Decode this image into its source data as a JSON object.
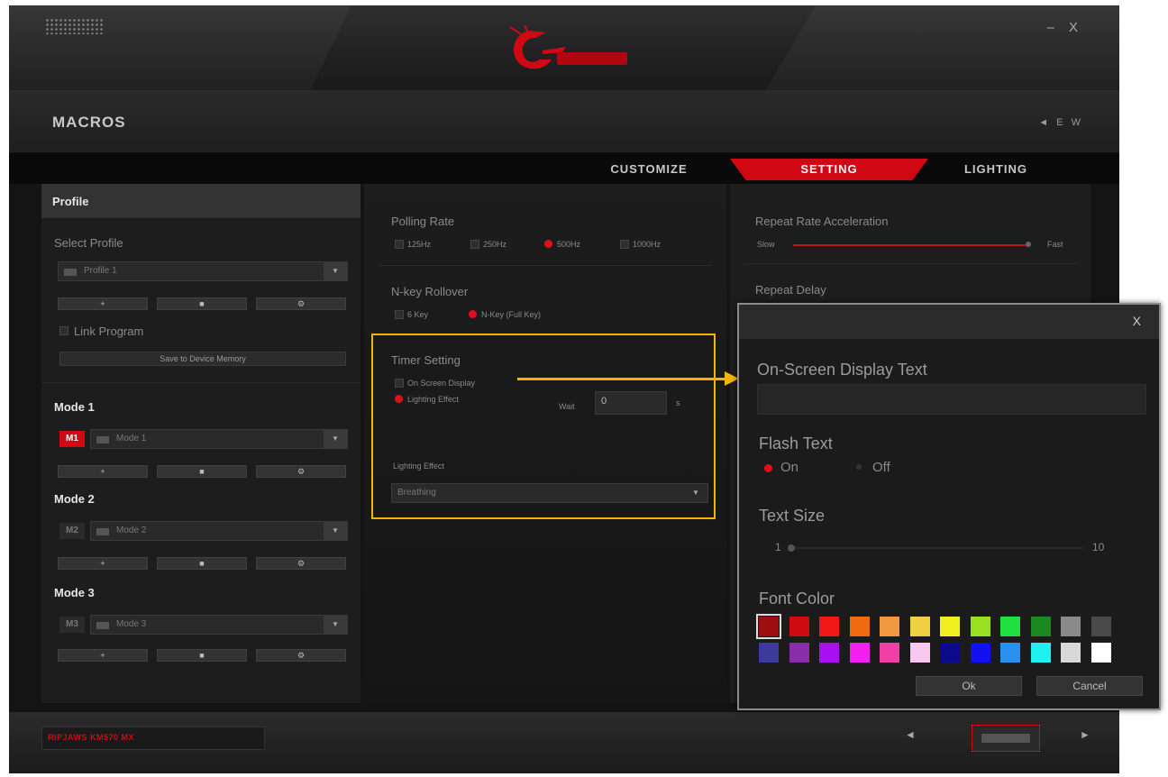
{
  "window": {
    "minimize": "–",
    "close": "X"
  },
  "header": {
    "page_title": "MACROS",
    "language": "◄ E W"
  },
  "tabs": [
    {
      "label": "CUSTOMIZE"
    },
    {
      "label": "SETTING"
    },
    {
      "label": "LIGHTING"
    }
  ],
  "profile": {
    "heading": "Profile",
    "select_label": "Select Profile",
    "selected": "Profile 1",
    "btn_add": "+",
    "btn_delete": "■",
    "btn_settings": "⚙",
    "link_program": "Link Program",
    "save_button": "Save to Device Memory"
  },
  "modes": [
    {
      "heading": "Mode 1",
      "badge": "M1",
      "selected": "Mode 1"
    },
    {
      "heading": "Mode 2",
      "badge": "M2",
      "selected": "Mode 2"
    },
    {
      "heading": "Mode 3",
      "badge": "M3",
      "selected": "Mode 3"
    }
  ],
  "polling": {
    "heading": "Polling Rate",
    "options": [
      "125Hz",
      "250Hz",
      "500Hz",
      "1000Hz"
    ],
    "selected": "500Hz"
  },
  "nkey": {
    "heading": "N-key Rollover",
    "options": [
      "6 Key",
      "N-Key (Full Key)"
    ],
    "selected": "N-Key (Full Key)"
  },
  "timer": {
    "heading": "Timer Setting",
    "opt_osd": "On Screen Display",
    "opt_lighting": "Lighting Effect",
    "wait_label": "Wait",
    "wait_value": "0",
    "wait_unit": "s",
    "effect_label": "Lighting Effect",
    "effect_selected": "Breathing"
  },
  "repeat": {
    "accel_heading": "Repeat Rate Acceleration",
    "slow": "Slow",
    "fast": "Fast",
    "delay_heading": "Repeat Delay"
  },
  "dialog": {
    "close": "X",
    "osd_label": "On-Screen Display Text",
    "osd_value": "",
    "flash_label": "Flash Text",
    "flash_on": "On",
    "flash_off": "Off",
    "flash_selected": "On",
    "size_label": "Text Size",
    "size_min": "1",
    "size_max": "10",
    "size_value": 1,
    "font_color_label": "Font Color",
    "selected_color": "#9e0e10",
    "colors": [
      "#9e0e10",
      "#d00a12",
      "#f01818",
      "#f06a10",
      "#f09840",
      "#f0d040",
      "#f0f020",
      "#98e020",
      "#20e040",
      "#1a8a20",
      "#8a8a8a",
      "#4a4a4a",
      "#3c3a9a",
      "#8a2ea8",
      "#a810f0",
      "#f020f0",
      "#f040a8",
      "#f8c8f0",
      "#0a0a8a",
      "#1010f0",
      "#2890f0",
      "#20f0f0",
      "#d8d8d8",
      "#ffffff"
    ],
    "ok": "Ok",
    "cancel": "Cancel"
  },
  "footer": {
    "model": "RIPJAWS KM570 MX"
  },
  "colors": {
    "accent": "#d00814",
    "highlight": "#f5b400"
  }
}
